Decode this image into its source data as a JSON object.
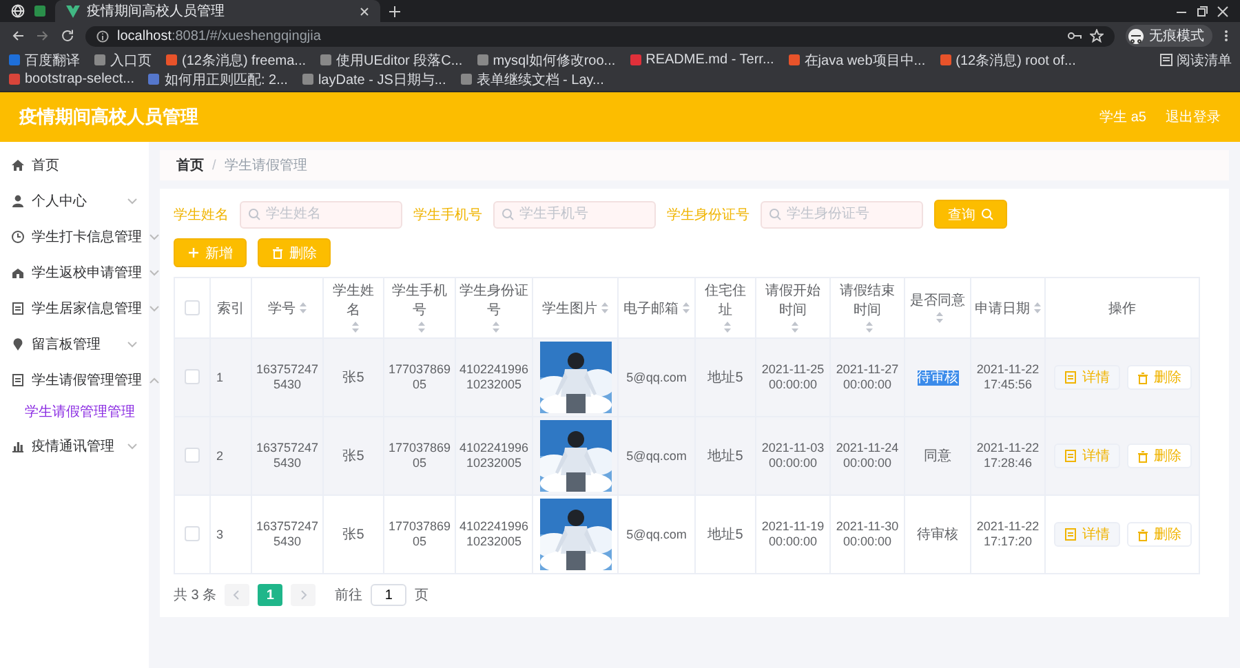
{
  "browser": {
    "tab_title": "疫情期间高校人员管理",
    "url_host": "localhost",
    "url_rest": ":8081/#/xueshengqingjia",
    "profile": "无痕模式",
    "bookmarks": [
      "百度翻译",
      "入口页",
      "(12条消息) freema...",
      "使用UEditor 段落C...",
      "mysql如何修改roo...",
      "README.md - Terr...",
      "在java web项目中...",
      "(12条消息) root of...",
      "bootstrap-select...",
      "如何用正则匹配: 2...",
      "layDate - JS日期与...",
      "表单继续文档 - Lay..."
    ],
    "reading_list": "阅读清单"
  },
  "header": {
    "title": "疫情期间高校人员管理",
    "user": "学生 a5",
    "logout": "退出登录"
  },
  "sidebar": {
    "items": [
      {
        "label": "首页",
        "kind": "link"
      },
      {
        "label": "个人中心",
        "kind": "menu",
        "expanded": false
      },
      {
        "label": "学生打卡信息管理",
        "kind": "menu",
        "expanded": false
      },
      {
        "label": "学生返校申请管理",
        "kind": "menu",
        "expanded": false
      },
      {
        "label": "学生居家信息管理",
        "kind": "menu",
        "expanded": false
      },
      {
        "label": "留言板管理",
        "kind": "menu",
        "expanded": false
      },
      {
        "label": "学生请假管理管理",
        "kind": "menu",
        "expanded": true,
        "children": [
          {
            "label": "学生请假管理管理",
            "selected": true
          }
        ]
      },
      {
        "label": "疫情通讯管理",
        "kind": "menu",
        "expanded": false
      }
    ]
  },
  "breadcrumb": [
    {
      "label": "首页",
      "current": false,
      "separator": "/"
    },
    {
      "label": "学生请假管理",
      "current": true
    }
  ],
  "search": {
    "fields": [
      {
        "label": "学生姓名",
        "placeholder": "学生姓名"
      },
      {
        "label": "学生手机号",
        "placeholder": "学生手机号"
      },
      {
        "label": "学生身份证号",
        "placeholder": "学生身份证号"
      }
    ],
    "button": "查询"
  },
  "toolbar": [
    {
      "label": "新增",
      "kind": "add"
    },
    {
      "label": "删除",
      "kind": "delete"
    }
  ],
  "table": {
    "header_checked": false,
    "columns": [
      {
        "label": "索引",
        "sortable": false
      },
      {
        "label": "学号",
        "sortable": true
      },
      {
        "label": "学生姓名",
        "sortable": true
      },
      {
        "label": "学生手机号",
        "sortable": true
      },
      {
        "label": "学生身份证号",
        "sortable": true
      },
      {
        "label": "学生图片",
        "sortable": true
      },
      {
        "label": "电子邮箱",
        "sortable": true
      },
      {
        "label": "住宅住址",
        "sortable": true
      },
      {
        "label": "请假开始时间",
        "sortable": true
      },
      {
        "label": "请假结束时间",
        "sortable": true
      },
      {
        "label": "是否同意",
        "sortable": true
      },
      {
        "label": "申请日期",
        "sortable": true
      },
      {
        "label": "操作",
        "sortable": false
      }
    ],
    "rows": [
      {
        "selected": false,
        "highlighted": true,
        "index": "1",
        "student_no": "1637572475430",
        "name": "张5",
        "phone": "17703786905",
        "id_number": "410224199610232005",
        "photo": {
          "kind": "picture"
        },
        "email": "5@qq.com",
        "address": "地址5",
        "leave_start": "2021-11-25 00:00:00",
        "leave_end": "2021-11-27 00:00:00",
        "approval": "待审核",
        "approval_text_selected": true,
        "applied_at": "2021-11-22 17:45:56",
        "actions": [
          {
            "label": "详情",
            "kind": "detail"
          },
          {
            "label": "删除",
            "kind": "delete"
          }
        ]
      },
      {
        "selected": false,
        "highlighted": true,
        "index": "2",
        "student_no": "1637572475430",
        "name": "张5",
        "phone": "17703786905",
        "id_number": "410224199610232005",
        "photo": {
          "kind": "picture"
        },
        "email": "5@qq.com",
        "address": "地址5",
        "leave_start": "2021-11-03 00:00:00",
        "leave_end": "2021-11-24 00:00:00",
        "approval": "同意",
        "approval_text_selected": false,
        "applied_at": "2021-11-22 17:28:46",
        "actions": [
          {
            "label": "详情",
            "kind": "detail"
          },
          {
            "label": "删除",
            "kind": "delete"
          }
        ]
      },
      {
        "selected": false,
        "highlighted": false,
        "index": "3",
        "student_no": "1637572475430",
        "name": "张5",
        "phone": "17703786905",
        "id_number": "410224199610232005",
        "photo": {
          "kind": "picture"
        },
        "email": "5@qq.com",
        "address": "地址5",
        "leave_start": "2021-11-19 00:00:00",
        "leave_end": "2021-11-30 00:00:00",
        "approval": "待审核",
        "approval_text_selected": false,
        "applied_at": "2021-11-22 17:17:20",
        "actions": [
          {
            "label": "详情",
            "kind": "detail"
          },
          {
            "label": "删除",
            "kind": "delete"
          }
        ]
      }
    ]
  },
  "pagination": {
    "total": "共 3 条",
    "pages": [
      {
        "label": "1",
        "selected": true
      }
    ],
    "goto_label": "前往",
    "goto_value": "1",
    "goto_suffix": "页"
  }
}
